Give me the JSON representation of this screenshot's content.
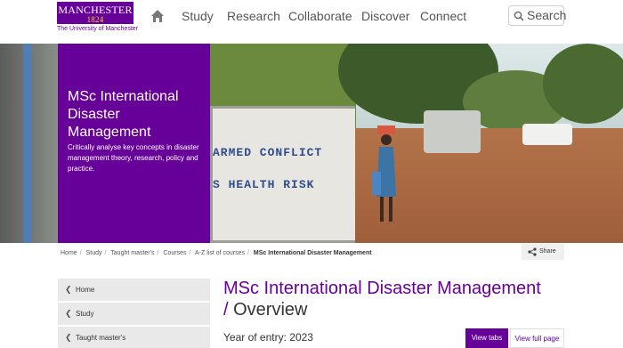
{
  "header": {
    "logo_main": "MANCHESTER",
    "logo_year": "1824",
    "logo_sub": "The University of Manchester",
    "nav": [
      "Study",
      "Research",
      "Collaborate",
      "Discover",
      "Connect"
    ],
    "search_label": "Search"
  },
  "hero": {
    "title": "MSc International Disaster Management",
    "description": "Critically analyse key concepts in disaster management theory, research, policy and practice.",
    "sign_lines": [
      "ARMED CONFLICT",
      "S HEALTH RISK"
    ]
  },
  "breadcrumb": {
    "items": [
      "Home",
      "Study",
      "Taught master's",
      "Courses",
      "A-Z list of courses"
    ],
    "current": "MSc International Disaster Management",
    "share_label": "Share"
  },
  "sidebar": {
    "items": [
      {
        "label": "Home"
      },
      {
        "label": "Study"
      },
      {
        "label": "Taught master's"
      }
    ]
  },
  "main": {
    "title": "MSc International Disaster Management",
    "subtitle_slash": "/",
    "subtitle": "Overview",
    "entry_label": "Year of entry: 2023",
    "view_tabs": "View tabs",
    "view_full": "View full page"
  },
  "colors": {
    "brand_purple": "#660099",
    "brand_gold": "#ffcc33"
  }
}
